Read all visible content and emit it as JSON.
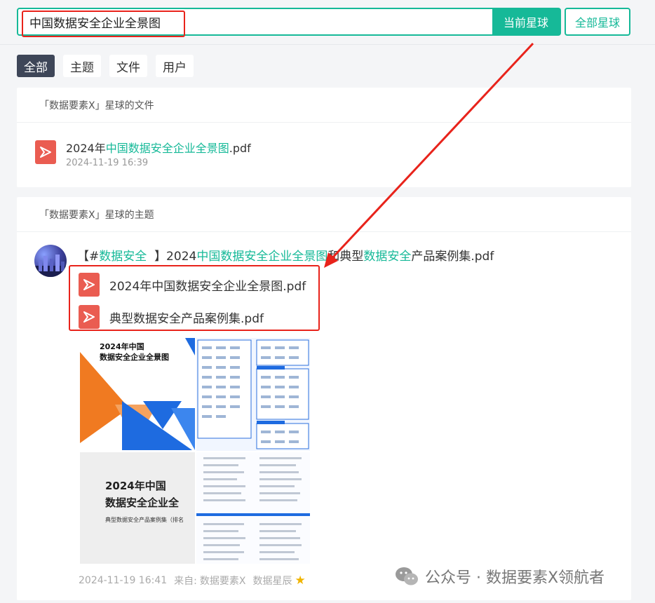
{
  "search": {
    "query": "中国数据安全企业全景图",
    "current_btn": "当前星球",
    "all_btn": "全部星球"
  },
  "tabs": [
    {
      "label": "全部",
      "active": true
    },
    {
      "label": "主题",
      "active": false
    },
    {
      "label": "文件",
      "active": false
    },
    {
      "label": "用户",
      "active": false
    }
  ],
  "files_section": {
    "header": "「数据要素X」星球的文件",
    "file": {
      "name_prefix": "2024年",
      "name_highlight": "中国数据安全企业全景图",
      "name_suffix": ".pdf",
      "date": "2024-11-19 16:39"
    }
  },
  "topics_section": {
    "header": "「数据要素X」星球的主题",
    "title": {
      "bracket_open": "【#",
      "tag": "数据安全",
      "bracket_close": "】2024",
      "hl1": "中国数据安全企业全景图",
      "mid": "和典型",
      "hl2": "数据安全",
      "tail": "产品案例集.pdf"
    },
    "attachments": [
      "2024年中国数据安全企业全景图.pdf",
      "典型数据安全产品案例集.pdf"
    ],
    "preview": {
      "cover_title_top": "2024年中国\n数据安全企业全景图",
      "cover_title_bottom_1": "2024年中国",
      "cover_title_bottom_2": "数据安全企业全",
      "cover_sub": "典型数据安全产品案例集（排名不分先后）"
    },
    "meta": {
      "date": "2024-11-19 16:41",
      "from_label": "来自:",
      "planet": "数据要素X",
      "author": "数据星辰"
    }
  },
  "watermark": {
    "text": "公众号 · 数据要素X领航者"
  },
  "colors": {
    "accent": "#16b998",
    "annotation_red": "#e8231b",
    "pdf_red": "#ea5c51",
    "tab_active_bg": "#3e4658"
  }
}
